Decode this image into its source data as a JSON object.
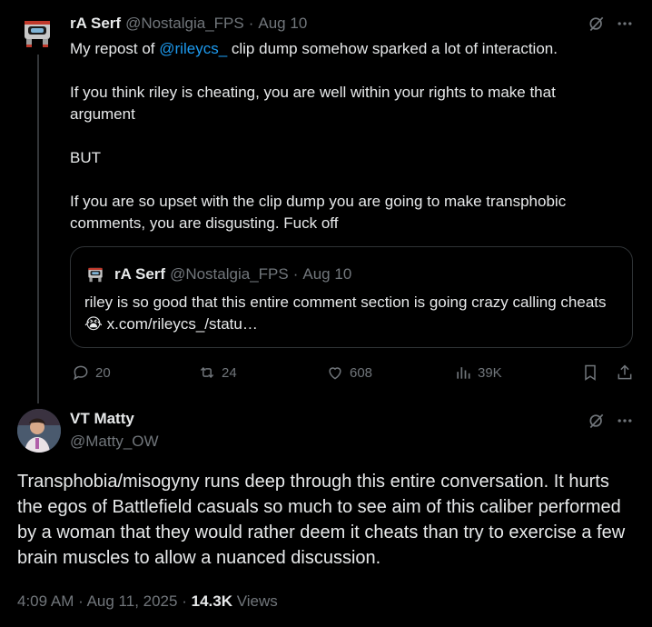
{
  "tweet1": {
    "name": "rA Serf",
    "handle": "@Nostalgia_FPS",
    "separator": "·",
    "date": "Aug 10",
    "lines": {
      "l1_pre": "My repost of ",
      "l1_mention": "@rileycs_",
      "l1_post": "  clip dump somehow sparked a lot of interaction.",
      "p2": "If you think riley is cheating, you are well within your rights to make that argument",
      "p3": "BUT",
      "p4": "If you are so upset with the clip dump you are going to make transphobic comments, you are disgusting. Fuck off"
    },
    "quote": {
      "name": "rA Serf",
      "handle": "@Nostalgia_FPS",
      "separator": "·",
      "date": "Aug 10",
      "text_pre": "riley is so good that this entire comment section is going crazy calling cheats ",
      "emoji": "😭",
      "text_link": " x.com/rileycs_/statu…"
    },
    "actions": {
      "replies": "20",
      "reposts": "24",
      "likes": "608",
      "views": "39K"
    }
  },
  "tweet2": {
    "name": "VT Matty",
    "handle": "@Matty_OW",
    "text": "Transphobia/misogyny runs deep through this entire conversation. It hurts the egos of Battlefield casuals so much to see aim of this caliber performed by a woman that they would rather deem it cheats than try to exercise a few brain muscles to allow a nuanced discussion.",
    "time": "4:09 AM",
    "dot": "·",
    "date": "Aug 11, 2025",
    "views_count": "14.3K",
    "views_label": "Views"
  },
  "colors": {
    "background": "#000000",
    "text": "#e7e9ea",
    "muted": "#71767b",
    "accent": "#1d9bf0",
    "border": "#2f3336"
  },
  "icons": [
    "grok-icon",
    "more-icon",
    "reply-icon",
    "repost-icon",
    "like-icon",
    "views-icon",
    "bookmark-icon",
    "share-icon"
  ]
}
